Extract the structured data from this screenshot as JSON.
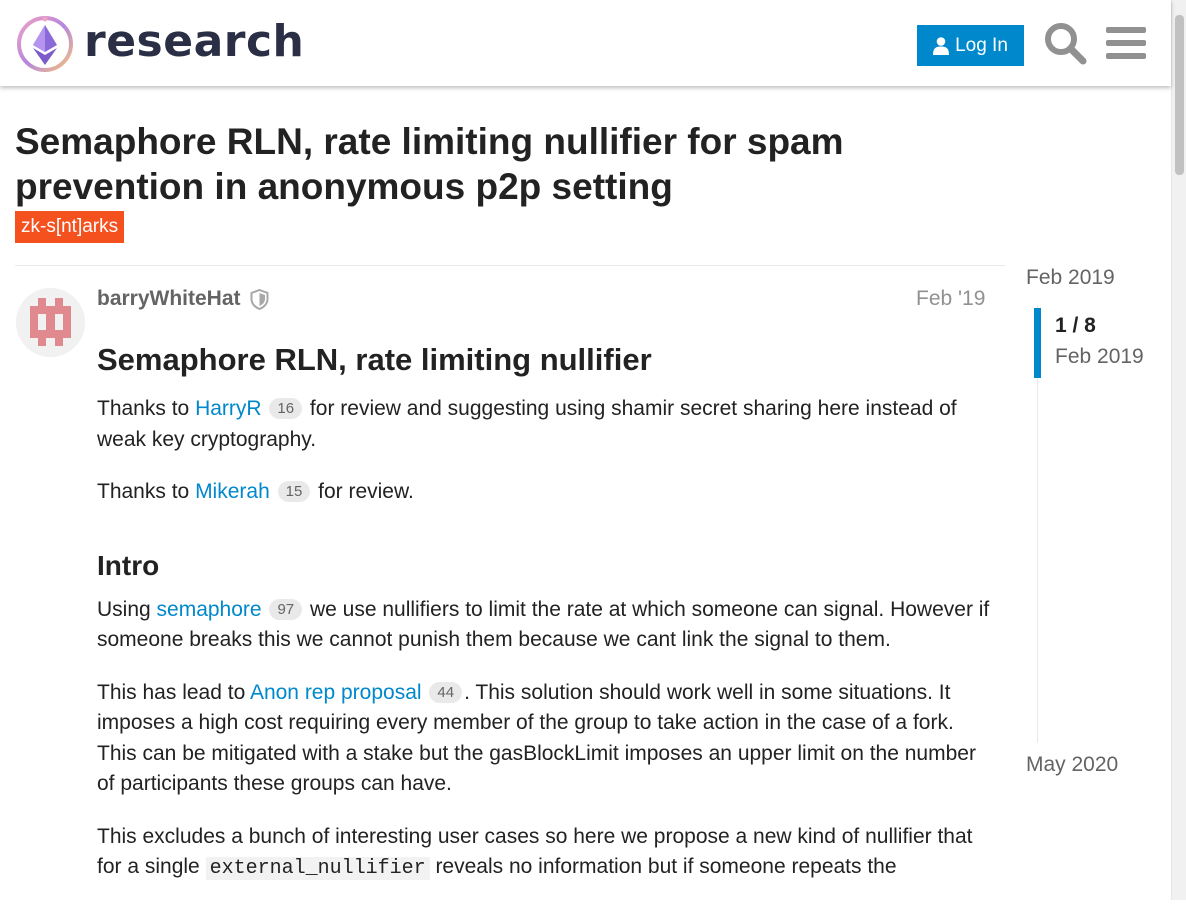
{
  "header": {
    "site_title": "research",
    "login_label": "Log In"
  },
  "topic": {
    "title": "Semaphore RLN, rate limiting nullifier for spam prevention in anonymous p2p setting",
    "category": "zk-s[nt]arks",
    "category_color": "#f4511e"
  },
  "post": {
    "username": "barryWhiteHat",
    "date": "Feb '19",
    "heading": "Semaphore RLN, rate limiting nullifier",
    "p1_a": "Thanks to ",
    "p1_link": "HarryR",
    "p1_badge": "16",
    "p1_b": " for review and suggesting using shamir secret sharing here instead of weak key cryptography.",
    "p2_a": "Thanks to ",
    "p2_link": "Mikerah",
    "p2_badge": "15",
    "p2_b": " for review.",
    "intro_heading": "Intro",
    "p3_a": "Using ",
    "p3_link": "semaphore",
    "p3_badge": "97",
    "p3_b": " we use nullifiers to limit the rate at which someone can signal. However if someone breaks this we cannot punish them because we cant link the signal to them.",
    "p4_a": "This has lead to ",
    "p4_link": "Anon rep proposal",
    "p4_badge": "44",
    "p4_b": ". This solution should work well in some situations. It imposes a high cost requiring every member of the group to take action in the case of a fork. This can be mitigated with a stake but the gasBlockLimit imposes an upper limit on the number of participants these groups can have.",
    "p5_a": "This excludes a bunch of interesting user cases so here we propose a new kind of nullifier that for a single ",
    "p5_code": "external_nullifier",
    "p5_b": " reveals no information but if someone repeats the"
  },
  "timeline": {
    "start_label": "Feb 2019",
    "position": "1 / 8",
    "position_date": "Feb 2019",
    "end_label": "May 2020"
  },
  "colors": {
    "accent": "#0088cc",
    "header_title": "#2a2f45",
    "avatar": "#e08a8f"
  }
}
